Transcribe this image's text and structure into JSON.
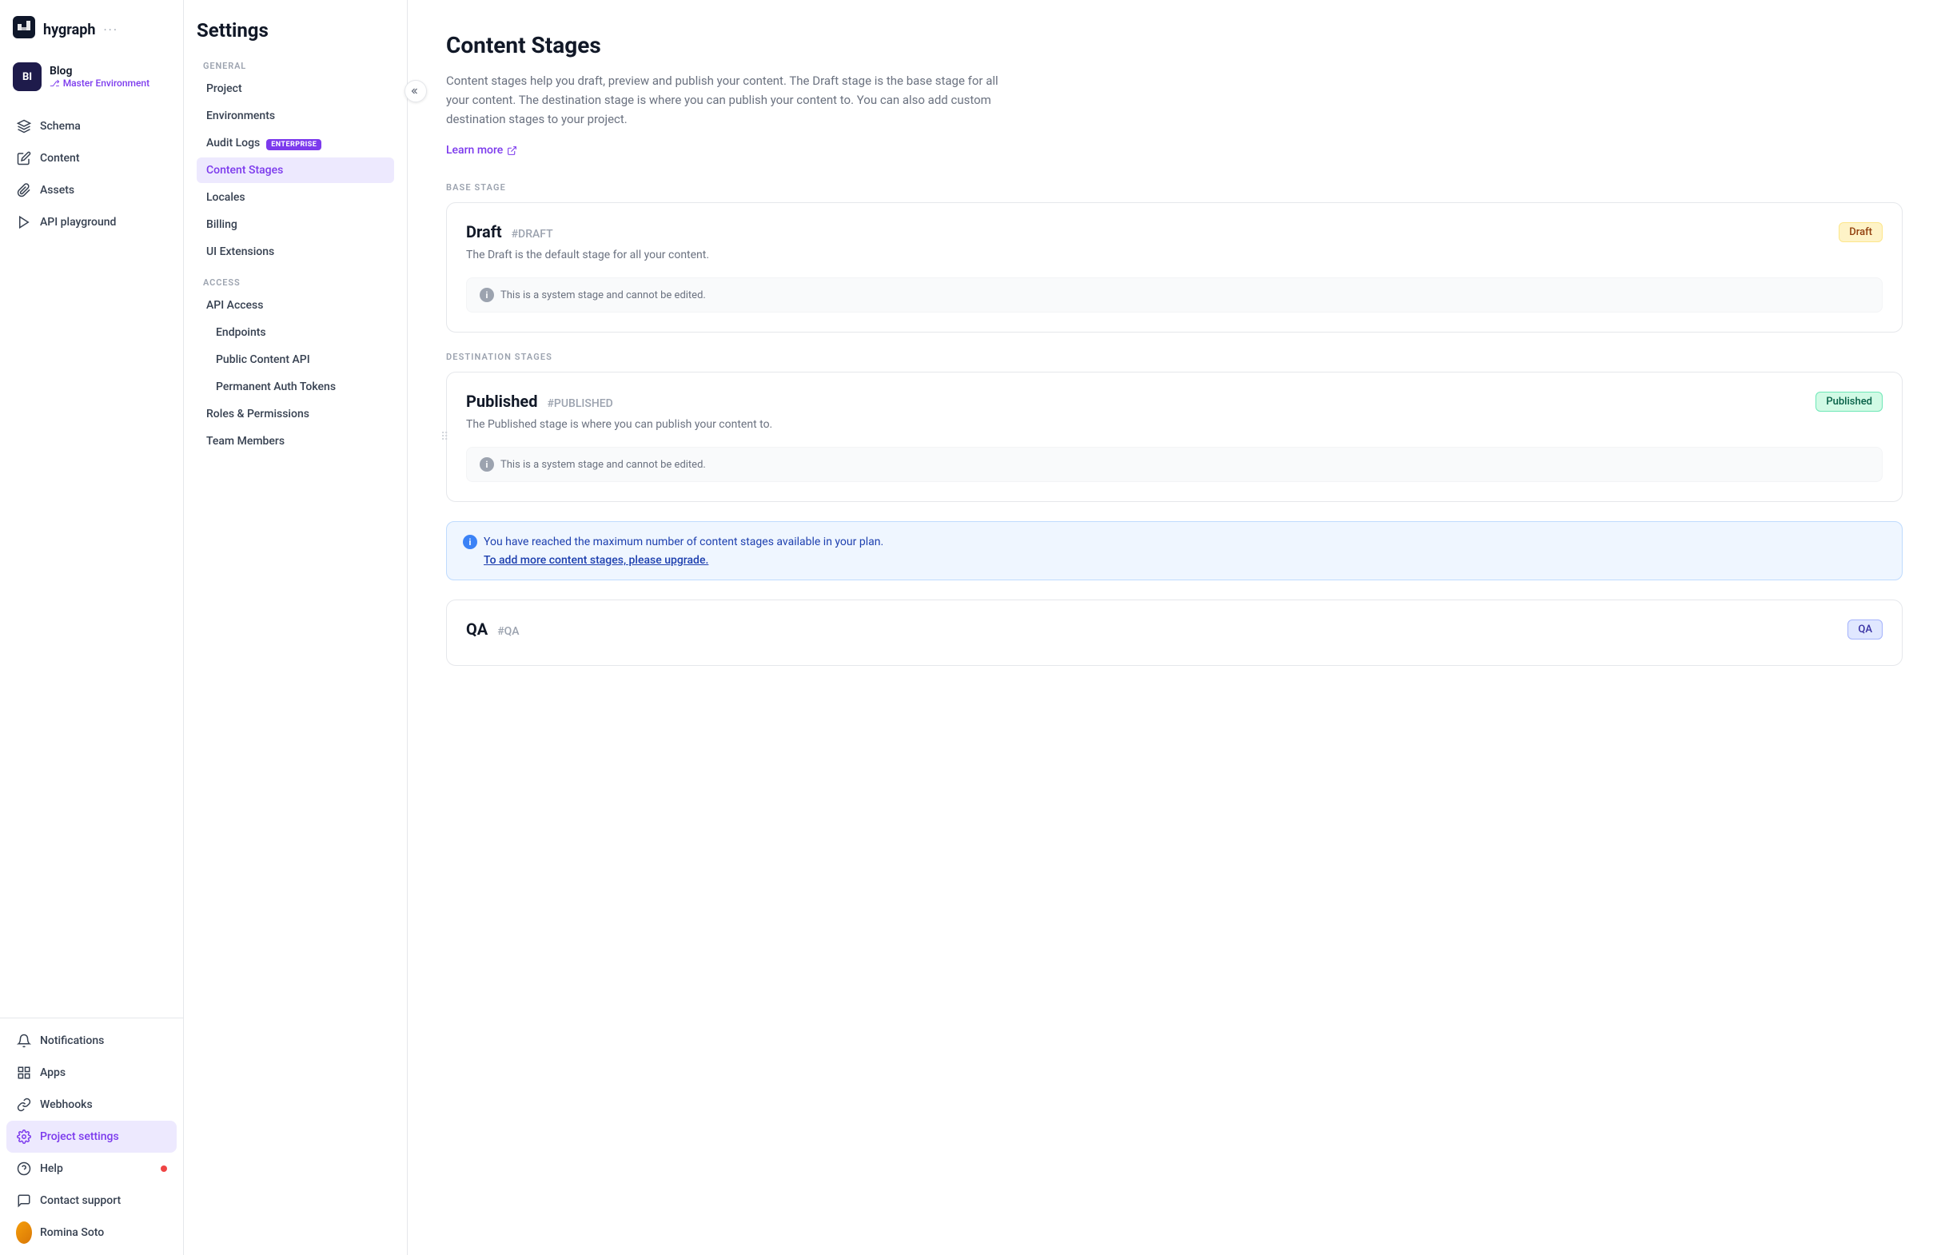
{
  "app": {
    "logo_text": "hygraph",
    "logo_dots": "···"
  },
  "project": {
    "avatar": "BI",
    "name": "Blog",
    "env_label": "Master Environment",
    "env_icon": "⎇"
  },
  "sidebar": {
    "nav_items": [
      {
        "id": "schema",
        "label": "Schema",
        "icon": "layers"
      },
      {
        "id": "content",
        "label": "Content",
        "icon": "edit"
      },
      {
        "id": "assets",
        "label": "Assets",
        "icon": "paperclip"
      },
      {
        "id": "api-playground",
        "label": "API playground",
        "icon": "play"
      }
    ],
    "bottom_items": [
      {
        "id": "notifications",
        "label": "Notifications",
        "icon": "bell",
        "active": false
      },
      {
        "id": "apps",
        "label": "Apps",
        "icon": "grid",
        "active": false
      },
      {
        "id": "webhooks",
        "label": "Webhooks",
        "icon": "link",
        "active": false
      },
      {
        "id": "project-settings",
        "label": "Project settings",
        "icon": "gear",
        "active": true
      },
      {
        "id": "help",
        "label": "Help",
        "icon": "help-circle",
        "active": false,
        "dot": true
      },
      {
        "id": "contact-support",
        "label": "Contact support",
        "icon": "message-square",
        "active": false
      },
      {
        "id": "romina",
        "label": "Romina Soto",
        "icon": "user",
        "active": false
      }
    ]
  },
  "settings": {
    "title": "Settings",
    "general_label": "GENERAL",
    "access_label": "ACCESS",
    "general_items": [
      {
        "id": "project",
        "label": "Project",
        "active": false
      },
      {
        "id": "environments",
        "label": "Environments",
        "active": false
      },
      {
        "id": "audit-logs",
        "label": "Audit Logs",
        "active": false,
        "badge": "ENTERPRISE"
      },
      {
        "id": "content-stages",
        "label": "Content Stages",
        "active": true
      },
      {
        "id": "locales",
        "label": "Locales",
        "active": false
      },
      {
        "id": "billing",
        "label": "Billing",
        "active": false
      },
      {
        "id": "ui-extensions",
        "label": "UI Extensions",
        "active": false
      }
    ],
    "access_items": [
      {
        "id": "api-access",
        "label": "API Access",
        "active": false
      },
      {
        "id": "endpoints",
        "label": "Endpoints",
        "active": false,
        "sub": true
      },
      {
        "id": "public-content-api",
        "label": "Public Content API",
        "active": false,
        "sub": true
      },
      {
        "id": "permanent-auth-tokens",
        "label": "Permanent Auth Tokens",
        "active": false,
        "sub": true
      },
      {
        "id": "roles-permissions",
        "label": "Roles & Permissions",
        "active": false
      },
      {
        "id": "team-members",
        "label": "Team Members",
        "active": false
      }
    ]
  },
  "content_stages": {
    "title": "Content Stages",
    "description": "Content stages help you draft, preview and publish your content. The Draft stage is the base stage for all your content. The destination stage is where you can publish your content to. You can also add custom destination stages to your project.",
    "learn_more": "Learn more",
    "base_stage_label": "BASE STAGE",
    "destination_stages_label": "DESTINATION STAGES",
    "collapse_button_title": "Collapse sidebar",
    "draft_stage": {
      "name": "Draft",
      "hash": "#DRAFT",
      "description": "The Draft is the default stage for all your content.",
      "badge": "Draft",
      "system_notice": "This is a system stage and cannot be edited."
    },
    "published_stage": {
      "name": "Published",
      "hash": "#PUBLISHED",
      "description": "The Published stage is where you can publish your content to.",
      "badge": "Published",
      "system_notice": "This is a system stage and cannot be edited."
    },
    "upgrade_notice": {
      "text": "You have reached the maximum number of content stages available in your plan.",
      "link_text": "To add more content stages, please upgrade."
    },
    "qa_stage": {
      "name": "QA",
      "hash": "#QA",
      "badge": "QA"
    }
  }
}
